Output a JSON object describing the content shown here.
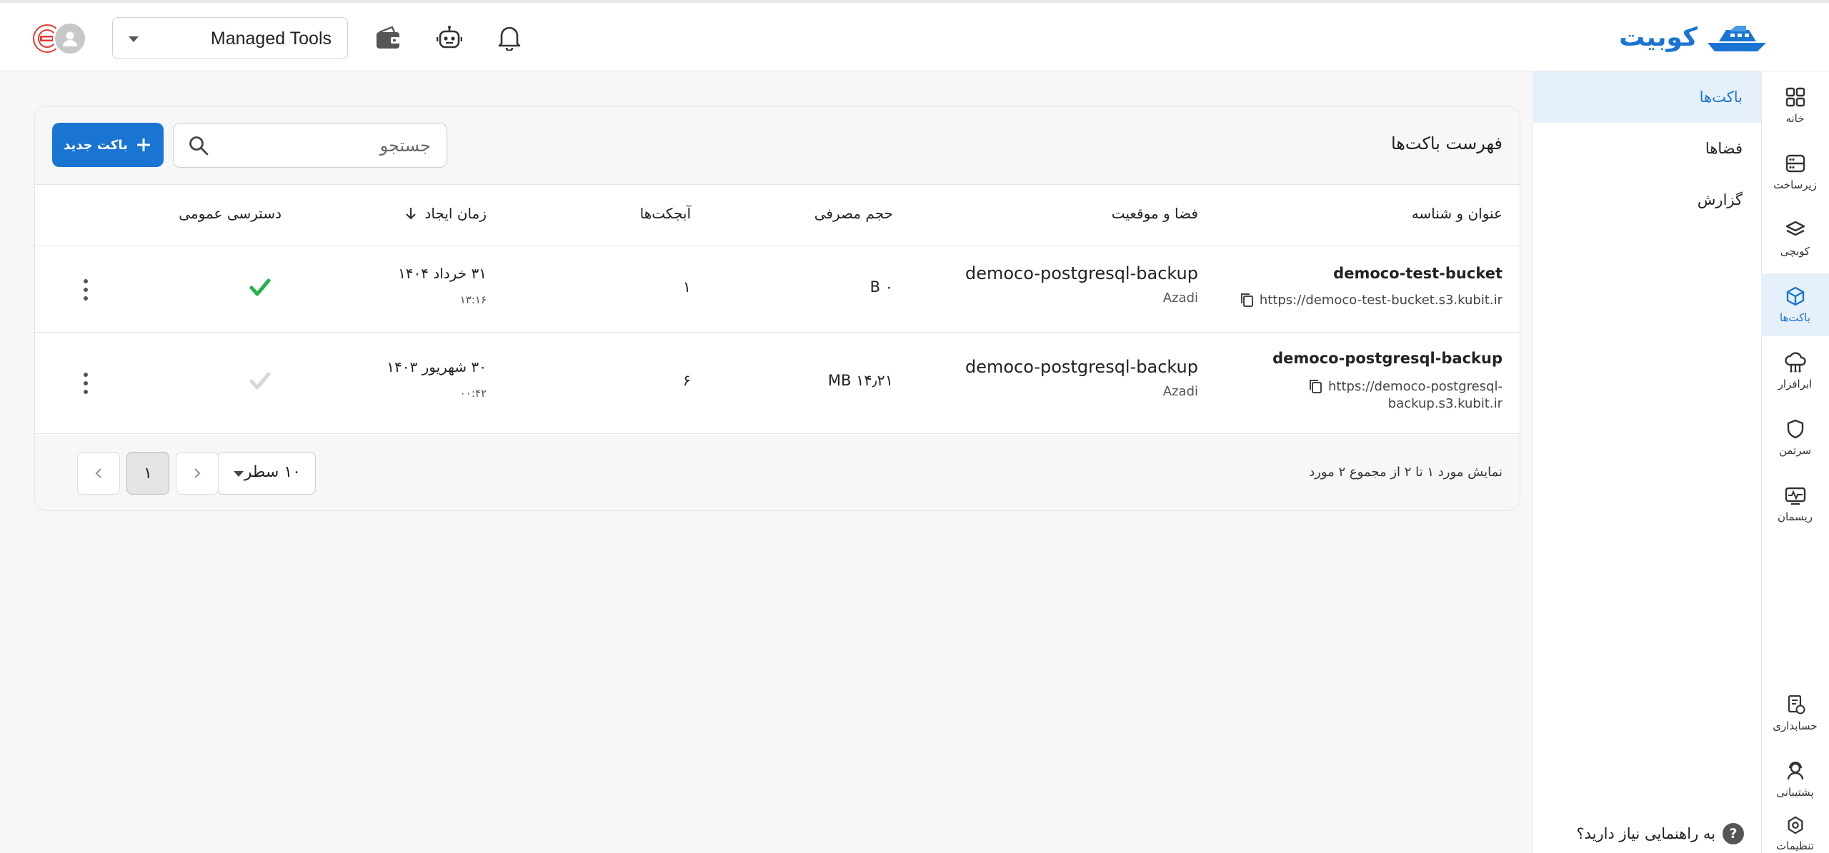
{
  "header": {
    "brand": "کوبیت",
    "tools_select": "Managed Tools"
  },
  "rail": [
    {
      "label": "خانه",
      "icon": "grid-icon"
    },
    {
      "label": "زیرساخت",
      "icon": "server-icon"
    },
    {
      "label": "کوبچی",
      "icon": "layers-icon"
    },
    {
      "label": "باکت‌ها",
      "icon": "cube-icon",
      "active": true
    },
    {
      "label": "ابرافزار",
      "icon": "cloud-app-icon"
    },
    {
      "label": "سرتمن",
      "icon": "shield-icon"
    },
    {
      "label": "ریسمان",
      "icon": "monitor-icon"
    },
    {
      "label": "حسابداری",
      "icon": "receipt-icon"
    },
    {
      "label": "پشتیبانی",
      "icon": "headset-icon"
    },
    {
      "label": "تنظیمات",
      "icon": "settings-icon"
    }
  ],
  "subnav": {
    "items": [
      {
        "label": "باکت‌ها",
        "active": true
      },
      {
        "label": "فضاها"
      },
      {
        "label": "گزارش"
      }
    ],
    "help": "به راهنمایی نیاز دارید؟",
    "help_icon": "?"
  },
  "card": {
    "title": "فهرست باکت‌ها",
    "search_placeholder": "جستجو",
    "new_button": "باکت جدید"
  },
  "table": {
    "columns": [
      "عنوان و شناسه",
      "فضا و موقعیت",
      "حجم مصرفی",
      "آبجکت‌ها",
      "زمان ایجاد",
      "دسترسی عمومی"
    ],
    "rows": [
      {
        "name": "democo-test-bucket",
        "url": "https://democo-test-bucket.s3.kubit.ir",
        "url_lines": [
          "https://democo-test-bucket.s3.kubit.ir"
        ],
        "space": "democo-postgresql-backup",
        "region": "Azadi",
        "size": "۰ B",
        "objects": "۱",
        "date": "۳۱ خرداد ۱۴۰۴",
        "time": "۱۳:۱۶",
        "public": true
      },
      {
        "name": "democo-postgresql-backup",
        "url": "https://democo-postgresql-backup.s3.kubit.ir",
        "url_lines": [
          "https://democo-postgresql-",
          "backup.s3.kubit.ir"
        ],
        "space": "democo-postgresql-backup",
        "region": "Azadi",
        "size": "۱۴٫۲۱ MB",
        "objects": "۶",
        "date": "۳۰ شهریور ۱۴۰۳",
        "time": "۰۰:۴۲",
        "public": false
      }
    ]
  },
  "footer": {
    "summary": "نمایش مورد ۱ تا ۲ از مجموع ۲ مورد",
    "rows_per_page": "۱۰ سطر",
    "current_page": "۱"
  },
  "colors": {
    "accent": "#1a75d2",
    "public_on": "#22b14c",
    "public_off": "#d6d6d6"
  }
}
